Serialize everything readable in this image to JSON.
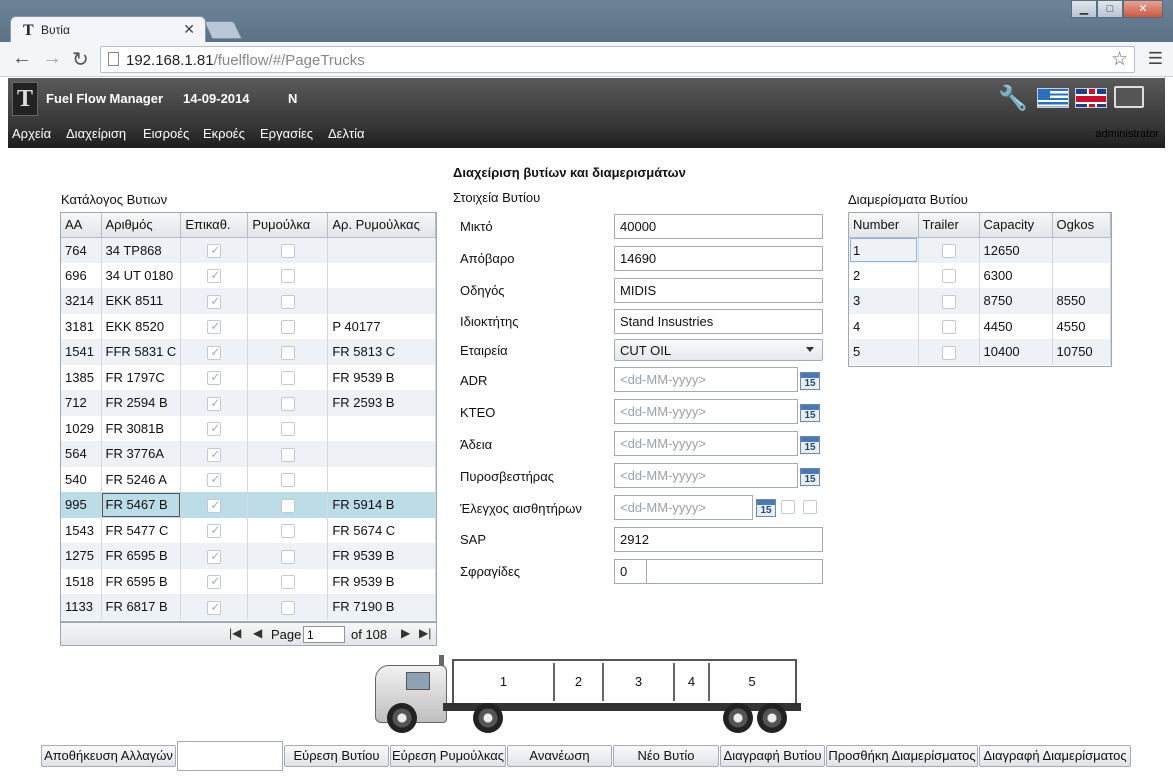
{
  "browser": {
    "tab_title": "Βυτία",
    "url_host": "192.168.1.81",
    "url_path": "/fuelflow/#/PageTrucks",
    "window_buttons": [
      "▁",
      "□",
      "✕"
    ]
  },
  "app": {
    "title": "Fuel Flow Manager",
    "date": "14-09-2014",
    "flag_letter": "N",
    "logo": "T",
    "user": "administrator",
    "menu": [
      "Αρχεία",
      "Διαχείριση",
      "Εισροές",
      "Εκροές",
      "Εργασίες",
      "Δελτία"
    ]
  },
  "page_title": "Διαχείριση βυτίων και διαμερισμάτων",
  "trucks_list": {
    "label": "Κατάλογος Βυτιων",
    "columns": [
      "AA",
      "Αριθμός",
      "Επικαθ.",
      "Ρυμούλκα",
      "Αρ. Ρυμούλκας"
    ],
    "rows": [
      {
        "aa": "764",
        "num": "34 TP868",
        "epik": true,
        "rym": false,
        "arrym": ""
      },
      {
        "aa": "696",
        "num": "34 UT 0180",
        "epik": true,
        "rym": false,
        "arrym": ""
      },
      {
        "aa": "3214",
        "num": "EKK 8511",
        "epik": true,
        "rym": false,
        "arrym": ""
      },
      {
        "aa": "3181",
        "num": "EKK 8520",
        "epik": true,
        "rym": false,
        "arrym": "P 40177"
      },
      {
        "aa": "1541",
        "num": "FFR 5831 C",
        "epik": true,
        "rym": false,
        "arrym": "FR 5813 C"
      },
      {
        "aa": "1385",
        "num": "FR 1797C",
        "epik": true,
        "rym": false,
        "arrym": "FR 9539 B"
      },
      {
        "aa": "712",
        "num": "FR 2594  B",
        "epik": true,
        "rym": false,
        "arrym": "FR 2593 B"
      },
      {
        "aa": "1029",
        "num": "FR 3081B",
        "epik": true,
        "rym": false,
        "arrym": ""
      },
      {
        "aa": "564",
        "num": "FR 3776A",
        "epik": true,
        "rym": false,
        "arrym": ""
      },
      {
        "aa": "540",
        "num": "FR 5246 A",
        "epik": true,
        "rym": false,
        "arrym": ""
      },
      {
        "aa": "995",
        "num": "FR 5467 B",
        "epik": true,
        "rym": false,
        "arrym": "FR 5914 B"
      },
      {
        "aa": "1543",
        "num": "FR 5477 C",
        "epik": true,
        "rym": false,
        "arrym": "FR 5674 C"
      },
      {
        "aa": "1275",
        "num": "FR 6595 B",
        "epik": true,
        "rym": false,
        "arrym": "FR 9539 B"
      },
      {
        "aa": "1518",
        "num": "FR 6595 B",
        "epik": true,
        "rym": false,
        "arrym": "FR 9539 B"
      },
      {
        "aa": "1133",
        "num": "FR 6817 B",
        "epik": true,
        "rym": false,
        "arrym": "FR 7190 B"
      }
    ],
    "selected_index": 10,
    "pager": {
      "page_label": "Page",
      "page_value": "1",
      "of_label": "of 108"
    }
  },
  "truck_details": {
    "label": "Στοιχεία Βυτίου",
    "fields": {
      "mikto": {
        "label": "Μικτό",
        "value": "40000"
      },
      "apovaro": {
        "label": "Απόβαρο",
        "value": "14690"
      },
      "odigos": {
        "label": "Οδηγός",
        "value": "MIDIS"
      },
      "idioktitis": {
        "label": "Ιδιοκτήτης",
        "value": "Stand Insustries"
      },
      "etaireia": {
        "label": "Εταιρεία",
        "value": "CUT OIL"
      },
      "adr": {
        "label": "ADR",
        "placeholder": "<dd-MM-yyyy>"
      },
      "kteo": {
        "label": "ΚΤΕΟ",
        "placeholder": "<dd-MM-yyyy>"
      },
      "adeia": {
        "label": "Άδεια",
        "placeholder": "<dd-MM-yyyy>"
      },
      "pyrosvestiras": {
        "label": "Πυροσβεστήρας",
        "placeholder": "<dd-MM-yyyy>"
      },
      "elegxos": {
        "label": "Έλεγχος αισθητήρων",
        "placeholder": "<dd-MM-yyyy>"
      },
      "sap": {
        "label": "SAP",
        "value": "2912"
      },
      "sfragides": {
        "label": "Σφραγίδες",
        "value": "0",
        "value2": ""
      }
    },
    "calendar_glyph": "15"
  },
  "compartments": {
    "label": "Διαμερίσματα Βυτίου",
    "columns": [
      "Number",
      "Trailer",
      "Capacity",
      "Ogkos"
    ],
    "rows": [
      {
        "number": "1",
        "trailer": false,
        "capacity": "12650",
        "ogkos": ""
      },
      {
        "number": "2",
        "trailer": false,
        "capacity": "6300",
        "ogkos": ""
      },
      {
        "number": "3",
        "trailer": false,
        "capacity": "8750",
        "ogkos": "8550"
      },
      {
        "number": "4",
        "trailer": false,
        "capacity": "4450",
        "ogkos": "4550"
      },
      {
        "number": "5",
        "trailer": false,
        "capacity": "10400",
        "ogkos": "10750"
      }
    ]
  },
  "truck_diagram": {
    "compartments": [
      "1",
      "2",
      "3",
      "4",
      "5"
    ]
  },
  "buttons": {
    "save": "Αποθήκευση Αλλαγών",
    "find_truck": "Εύρεση Βυτίου",
    "find_trailer": "Εύρεση Ρυμούλκας",
    "refresh": "Ανανέωση",
    "new_truck": "Νέο Βυτίο",
    "delete_truck": "Διαγραφή Βυτίου",
    "add_compartment": "Προσθήκη Διαμερίσματος",
    "delete_compartment": "Διαγραφή Διαμερίσματος"
  }
}
